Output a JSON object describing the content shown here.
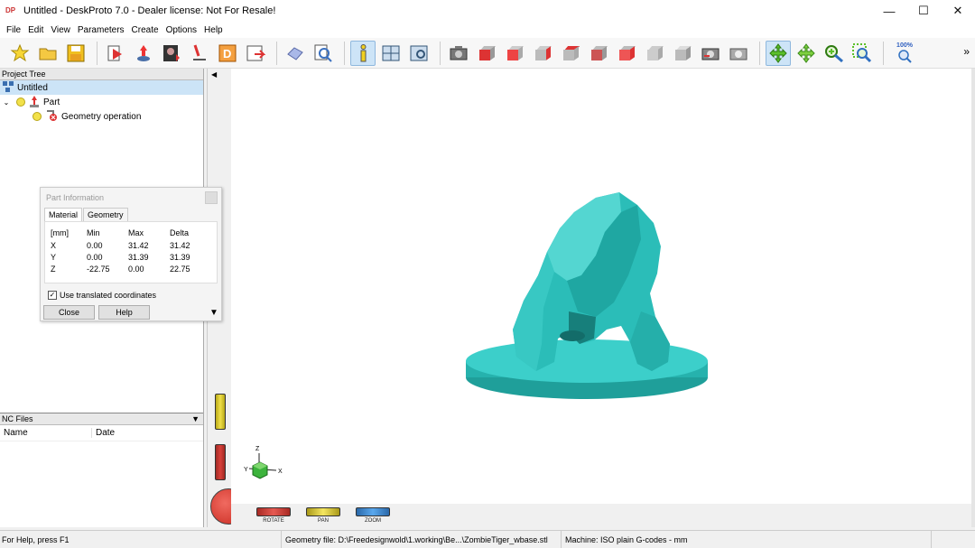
{
  "window": {
    "app_icon_text": "DP",
    "title": "Untitled - DeskProto 7.0 - Dealer license: Not For Resale!"
  },
  "menu": [
    "File",
    "Edit",
    "View",
    "Parameters",
    "Create",
    "Options",
    "Help"
  ],
  "toolbar": {
    "zoom_label": "100%"
  },
  "project_tree": {
    "header": "Project Tree",
    "root": "Untitled",
    "part": "Part",
    "operation": "Geometry operation"
  },
  "nc_files": {
    "header": "NC Files",
    "col_name": "Name",
    "col_date": "Date"
  },
  "part_info": {
    "title": "Part Information",
    "tabs": [
      "Material",
      "Geometry"
    ],
    "header": [
      "[mm]",
      "Min",
      "Max",
      "Delta"
    ],
    "rows": [
      [
        "X",
        "0.00",
        "31.42",
        "31.42"
      ],
      [
        "Y",
        "0.00",
        "31.39",
        "31.39"
      ],
      [
        "Z",
        "-22.75",
        "0.00",
        "22.75"
      ]
    ],
    "checkbox_label": "Use translated coordinates",
    "checkbox_checked": true,
    "close_label": "Close",
    "help_label": "Help"
  },
  "axes": {
    "z": "Z",
    "y": "Y",
    "x": "X"
  },
  "view_controls": {
    "rotate": "ROTATE",
    "pan": "PAN",
    "zoom": "ZOOM"
  },
  "status": {
    "help": "For Help, press F1",
    "geometry_file": "Geometry file: D:\\Freedesignwold\\1.working\\Be...\\ZombieTiger_wbase.stl",
    "machine": "Machine: ISO plain G-codes - mm"
  },
  "colors": {
    "model": "#2bbdb8",
    "rotate": "#d9403a",
    "pan": "#f0e04a",
    "zoom": "#3a8fd9"
  }
}
